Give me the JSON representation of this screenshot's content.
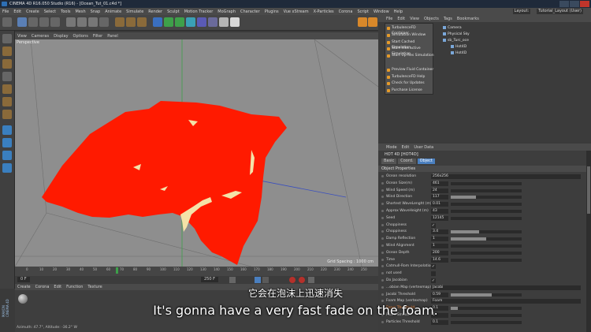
{
  "window": {
    "title": "CINEMA 4D R16.050 Studio (R16) - [Ocean_Tut_01.c4d *]"
  },
  "menu": [
    "File",
    "Edit",
    "Create",
    "Select",
    "Tools",
    "Mesh",
    "Snap",
    "Animate",
    "Simulate",
    "Render",
    "Sculpt",
    "Motion Tracker",
    "MoGraph",
    "Character",
    "Plugins",
    "Vue xStream",
    "X-Particles",
    "Corona",
    "Script",
    "Window",
    "Help"
  ],
  "layout": {
    "label": "Layout:",
    "value": "Tutorial_Layout (User)"
  },
  "viewport": {
    "menu": [
      "View",
      "Cameras",
      "Display",
      "Options",
      "Filter",
      "Panel"
    ],
    "label": "Perspective",
    "grid_spacing": "Grid Spacing : 1000 cm",
    "colors": {
      "background": "#8e8e8e",
      "mesh": "#ff1a00",
      "foam": "#f4e2a8"
    }
  },
  "timeline": {
    "start": "0 F",
    "end": "250 F",
    "current": "0 F",
    "marks": [
      "0",
      "10",
      "20",
      "30",
      "40",
      "50",
      "60",
      "70",
      "80",
      "90",
      "100",
      "110",
      "120",
      "130",
      "140",
      "150",
      "160",
      "170",
      "180",
      "190",
      "200",
      "210",
      "220",
      "230",
      "240",
      "250"
    ]
  },
  "plugin_menu": {
    "items": [
      "TurbulenceFD Container",
      "Simulation Window",
      "Start Cached Simulation",
      "Start Interactive Simulation",
      "Start Up-Res Simulation",
      "",
      "Preview Fluid Container",
      "TurbulenceFD Help",
      "Check for Updates",
      "Purchase License"
    ]
  },
  "object_manager": {
    "menu": [
      "File",
      "Edit",
      "View",
      "Objects",
      "Tags",
      "Bookmarks"
    ],
    "objects": [
      "Camera",
      "Physical Sky",
      "sb_Turc_oce",
      "Hot4D",
      "Hot4D"
    ]
  },
  "material_manager": {
    "menu": [
      "Create",
      "Corona",
      "Edit",
      "Function",
      "Texture"
    ]
  },
  "status": "Azimuth: 47.7°, Altitude: -36.2° W",
  "brand": "MAXON CINEMA 4D",
  "attributes": {
    "menu": [
      "Mode",
      "Edit",
      "User Data"
    ],
    "title": "HOT 4D [HOT4D]",
    "tabs": [
      "Basic",
      "Coord.",
      "Object"
    ],
    "active_tab": "Object",
    "section": "Object Properties",
    "rows": [
      {
        "label": "Ocean resolution",
        "wide": "256x256"
      },
      {
        "label": "Ocean Size(m)",
        "value": "461",
        "fill": 0.0
      },
      {
        "label": "Wind Speed (m)",
        "value": "24",
        "fill": 0.0
      },
      {
        "label": "Wind Direction",
        "value": "117",
        "fill": 0.35
      },
      {
        "label": "Shortest WaveLenght (m)",
        "value": "0.01",
        "fill": 0.0
      },
      {
        "label": "Approx WaveHeight (m)",
        "value": "43",
        "fill": 0.0
      },
      {
        "label": "Seed",
        "value": "12145",
        "fill": 0.0
      },
      {
        "label": "Choppiness",
        "check": "✓"
      },
      {
        "label": "Choppiness",
        "value": "3.4",
        "fill": 0.4
      },
      {
        "label": "Damp Reflection",
        "value": "1",
        "fill": 0.5
      },
      {
        "label": "Wind Alignment",
        "value": "1",
        "fill": 0.0
      },
      {
        "label": "Ocean Depth",
        "value": "200",
        "fill": 0.0
      },
      {
        "label": "Time",
        "value": "14.6",
        "fill": 0.0
      },
      {
        "label": "Catmull-Rom Interpolation",
        "check": "✓"
      },
      {
        "label": "not used",
        "check": ""
      },
      {
        "label": "Do Jacobian",
        "check": "✓"
      },
      {
        "label": "...obian Map (vertexmap)",
        "wide": "Jacobi"
      },
      {
        "label": "Jacobi Threshold",
        "value": "0.59",
        "fill": 0.58
      },
      {
        "label": "Foam Map (vertexmap)",
        "wide": "Foam"
      },
      {
        "label": "Foam Threshold",
        "value": "0.1",
        "fill": 0.1,
        "highlight": true
      },
      {
        "label": "Foam Smooth",
        "value": "1",
        "fill": 0.0
      },
      {
        "label": "Particles Threshold",
        "value": "0.1",
        "fill": 0.0
      }
    ]
  },
  "subtitles": {
    "zh": "它会在泡沫上迅速消失",
    "en": "It's gonna have a very fast fade on the foam."
  }
}
